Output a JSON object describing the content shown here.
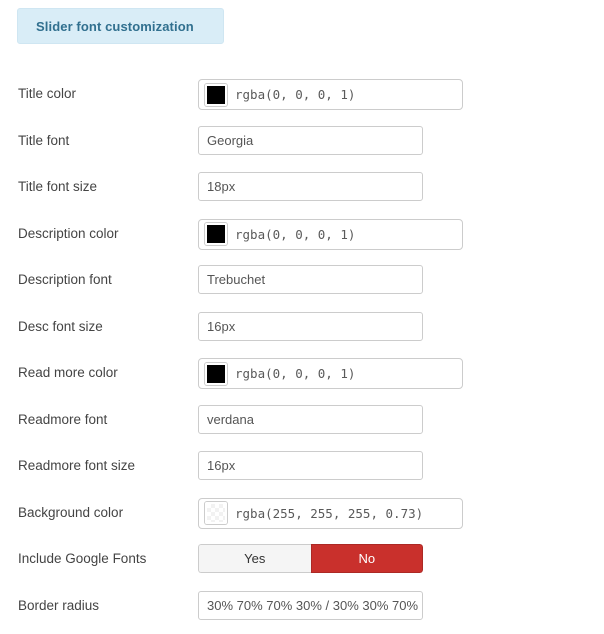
{
  "header": {
    "title": "Slider font customization",
    "background_color": "#d9edf7",
    "text_color": "#31708f"
  },
  "form": {
    "rows": [
      {
        "label": "Title color",
        "type": "color",
        "value": "rgba(0, 0, 0, 1)",
        "swatch_color": "rgba(0, 0, 0, 1)"
      },
      {
        "label": "Title font",
        "type": "text",
        "value": "Georgia"
      },
      {
        "label": "Title font size",
        "type": "text",
        "value": "18px"
      },
      {
        "label": "Description color",
        "type": "color",
        "value": "rgba(0, 0, 0, 1)",
        "swatch_color": "rgba(0, 0, 0, 1)"
      },
      {
        "label": "Description font",
        "type": "text",
        "value": "Trebuchet"
      },
      {
        "label": "Desc font size",
        "type": "text",
        "value": "16px"
      },
      {
        "label": "Read more color",
        "type": "color",
        "value": "rgba(0, 0, 0, 1)",
        "swatch_color": "rgba(0, 0, 0, 1)"
      },
      {
        "label": "Readmore font",
        "type": "text",
        "value": "verdana"
      },
      {
        "label": "Readmore font size",
        "type": "text",
        "value": "16px"
      },
      {
        "label": "Background color",
        "type": "color",
        "value": "rgba(255, 255, 255, 0.73)",
        "swatch_color": "rgba(255, 255, 255, 0.73)"
      },
      {
        "label": "Include Google Fonts",
        "type": "toggle",
        "options": [
          "Yes",
          "No"
        ],
        "selected": "No",
        "active_color": "#c9302c",
        "inactive_color": "#f5f5f5"
      },
      {
        "label": "Border radius",
        "type": "text",
        "value": "30% 70% 70% 30% / 30% 30% 70%"
      }
    ]
  }
}
